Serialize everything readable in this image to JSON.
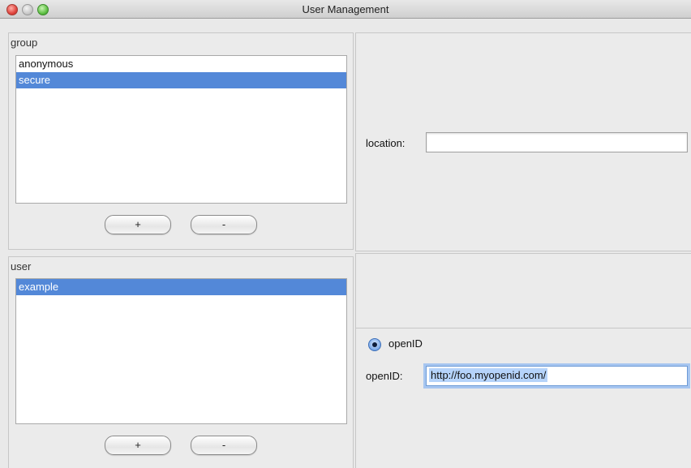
{
  "window": {
    "title": "User Management"
  },
  "group_panel": {
    "legend": "group",
    "items": [
      "anonymous",
      "secure"
    ],
    "selected_index": 1,
    "add_label": "+",
    "remove_label": "-"
  },
  "user_panel": {
    "legend": "user",
    "items": [
      "example"
    ],
    "selected_index": 0,
    "add_label": "+",
    "remove_label": "-"
  },
  "group_detail": {
    "location_label": "location:",
    "location_value": ""
  },
  "user_detail": {
    "radio_label": "openID",
    "radio_checked": true,
    "openid_label": "openID:",
    "openid_value": "http://foo.myopenid.com/"
  },
  "colors": {
    "selection": "#5388d8",
    "focus_ring": "#a7c6f0"
  }
}
